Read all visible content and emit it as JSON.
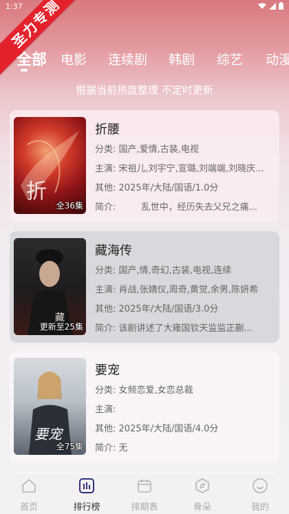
{
  "status_bar": {
    "time": "1:37"
  },
  "ribbon": {
    "text": "圣力专测"
  },
  "tabs": [
    {
      "label": "全部",
      "active": true
    },
    {
      "label": "电影"
    },
    {
      "label": "连续剧"
    },
    {
      "label": "韩剧"
    },
    {
      "label": "综艺"
    },
    {
      "label": "动漫"
    }
  ],
  "subtitle": "根据当前热度整理 不定时更新",
  "field_labels": {
    "category": "分类:",
    "cast": "主演:",
    "other": "其他:",
    "intro": "简介:"
  },
  "items": [
    {
      "title": "折腰",
      "badge": "全36集",
      "category": "国产,爱情,古装,电视",
      "cast": "宋祖儿,刘宇宁,宣璐,刘端端,刘晓庆...",
      "other": "2025年/大陆/国语/1.0分",
      "intro": "        乱世中，经历失去父兄之痛...",
      "poster_text": "折腰"
    },
    {
      "title": "藏海传",
      "badge": "更新至25集",
      "category": "国产,情,奇幻,古装,电视,连续",
      "cast": "肖战,张婧仪,周奇,黄觉,余男,陈妍希",
      "other": "2025年/大陆/国语/3.0分",
      "intro": "该剧讲述了大雍国钦天监监正蒯...",
      "poster_text": "藏海传"
    },
    {
      "title": "要宠",
      "badge": "全75集",
      "category": "女频恋爱,女恋总裁",
      "cast": "",
      "other": "2025年/大陆/国语/4.0分",
      "intro": "无",
      "poster_text": "要宠"
    }
  ],
  "bottom_nav": [
    {
      "label": "首页",
      "icon": "home-icon"
    },
    {
      "label": "排行榜",
      "icon": "ranking-icon",
      "active": true
    },
    {
      "label": "排期表",
      "icon": "calendar-icon"
    },
    {
      "label": "骨朵",
      "icon": "compass-icon"
    },
    {
      "label": "我的",
      "icon": "profile-icon"
    }
  ],
  "colors": {
    "ribbon": "#e4222c",
    "active_nav": "#333333",
    "inactive_nav": "#a9a9a9",
    "accent_icon": "#2d2f7a"
  }
}
